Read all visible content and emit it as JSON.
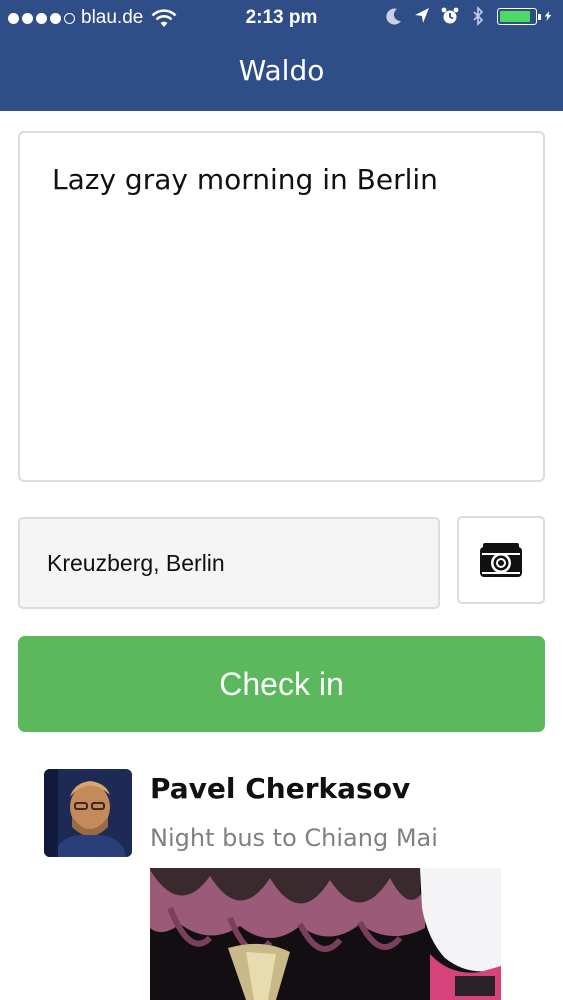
{
  "status_bar": {
    "carrier": "blau.de",
    "time": "2:13 pm",
    "signal_bars_filled": 4,
    "signal_bars_total": 5,
    "battery_level": 0.9,
    "icons": [
      "wifi-icon",
      "moon-icon",
      "location-arrow-icon",
      "alarm-icon",
      "bluetooth-icon",
      "battery-icon",
      "charging-bolt-icon"
    ]
  },
  "nav": {
    "title": "Waldo"
  },
  "compose": {
    "status_text": "Lazy gray morning in Berlin",
    "location_value": "Kreuzberg, Berlin",
    "camera_icon": "camera-icon",
    "checkin_label": "Check in"
  },
  "feed": [
    {
      "name": "Pavel Cherkasov",
      "message": "Night bus to Chiang Mai"
    }
  ],
  "colors": {
    "header": "#2f4d87",
    "checkin": "#5cb85c",
    "battery": "#4cd964",
    "field_bg": "#f5f5f5",
    "border": "#dcdcdc"
  }
}
